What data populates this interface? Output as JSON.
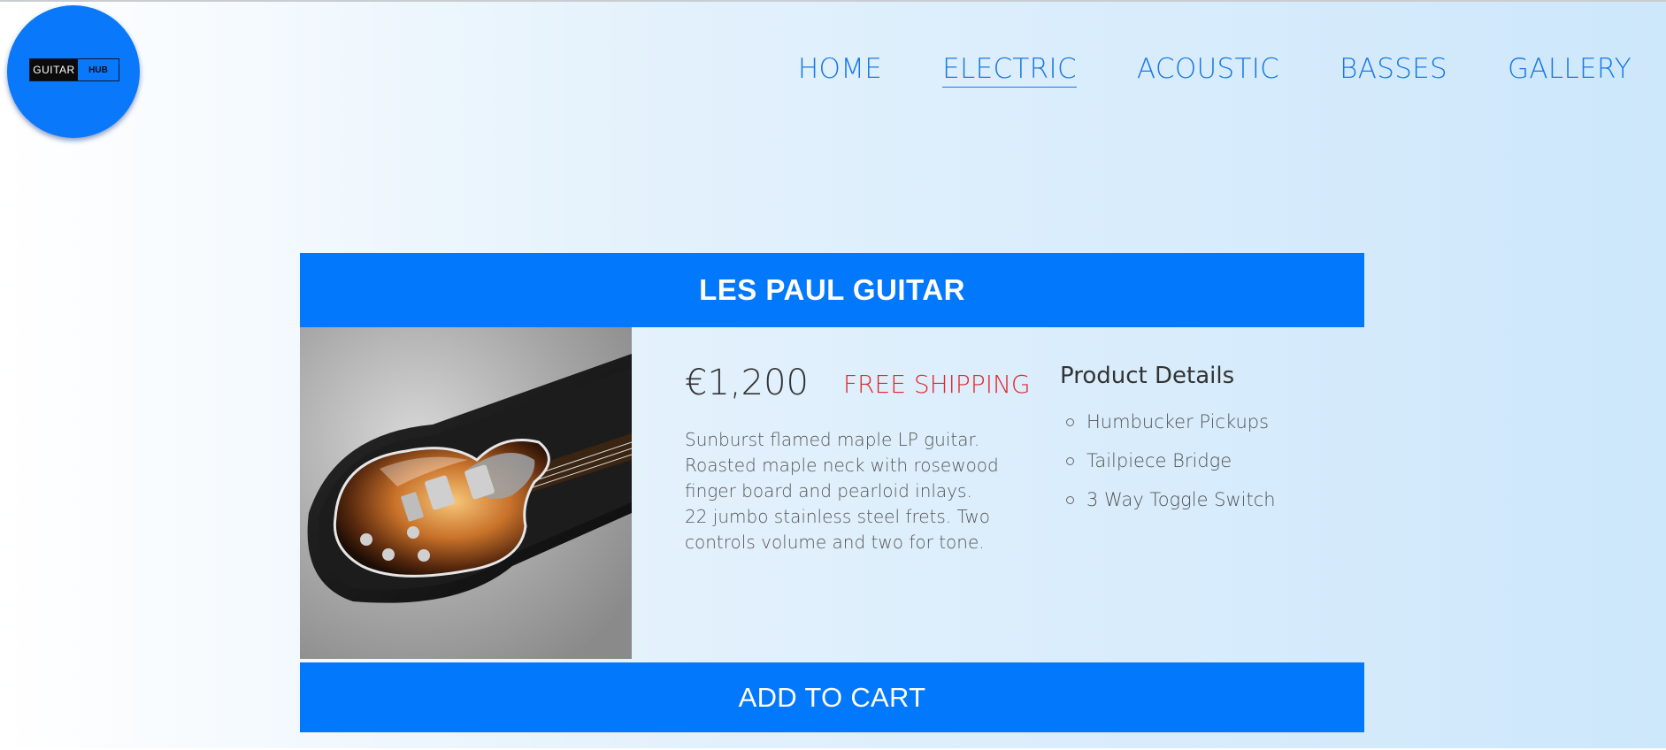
{
  "logo": {
    "text_part1": "GUITAR",
    "text_part2": "HUB",
    "circle_color": "#0a78fb"
  },
  "nav": {
    "items": [
      {
        "label": "HOME",
        "active": false
      },
      {
        "label": "ELECTRIC",
        "active": true
      },
      {
        "label": "ACOUSTIC",
        "active": false
      },
      {
        "label": "BASSES",
        "active": false
      },
      {
        "label": "GALLERY",
        "active": false
      }
    ]
  },
  "product": {
    "title": "LES PAUL GUITAR",
    "price": "€1,200",
    "shipping": "FREE SHIPPING",
    "description": "Sunburst flamed maple LP guitar. Roasted maple neck with rosewood finger board and pearloid inlays. 22 jumbo stainless steel frets. Two controls volume and two for tone.",
    "details_title": "Product Details",
    "details": [
      "Humbucker Pickups",
      "Tailpiece Bridge",
      "3 Way Toggle Switch"
    ],
    "image_icon": "guitar-in-case-photo"
  },
  "cart": {
    "label": "ADD TO CART"
  },
  "colors": {
    "accent": "#0278fc",
    "nav_text": "#1a78e6",
    "shipping": "#e4262a"
  }
}
